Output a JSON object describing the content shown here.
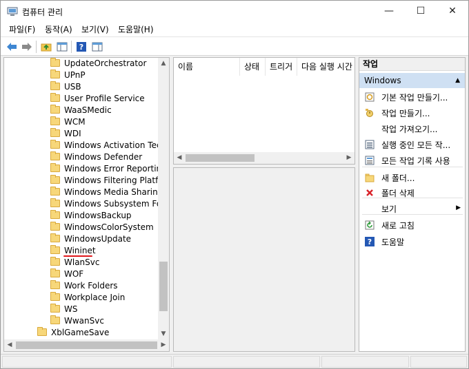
{
  "window": {
    "title": "컴퓨터 관리",
    "minimize_glyph": "—",
    "maximize_glyph": "☐",
    "close_glyph": "✕"
  },
  "menu": {
    "items": [
      "파일(F)",
      "동작(A)",
      "보기(V)",
      "도움말(H)"
    ]
  },
  "toolbar": {
    "icons": [
      "back-arrow-icon",
      "forward-arrow-icon",
      "up-folder-icon",
      "show-hide-tree-icon",
      "help-icon",
      "show-hide-action-pane-icon"
    ]
  },
  "tree": {
    "items": [
      {
        "label": "UpdateOrchestrator",
        "level": 2
      },
      {
        "label": "UPnP",
        "level": 2
      },
      {
        "label": "USB",
        "level": 2
      },
      {
        "label": "User Profile Service",
        "level": 2
      },
      {
        "label": "WaaSMedic",
        "level": 2
      },
      {
        "label": "WCM",
        "level": 2
      },
      {
        "label": "WDI",
        "level": 2
      },
      {
        "label": "Windows Activation Technologies",
        "level": 2
      },
      {
        "label": "Windows Defender",
        "level": 2
      },
      {
        "label": "Windows Error Reporting",
        "level": 2
      },
      {
        "label": "Windows Filtering Platform",
        "level": 2
      },
      {
        "label": "Windows Media Sharing",
        "level": 2
      },
      {
        "label": "Windows Subsystem For Linux",
        "level": 2
      },
      {
        "label": "WindowsBackup",
        "level": 2
      },
      {
        "label": "WindowsColorSystem",
        "level": 2
      },
      {
        "label": "WindowsUpdate",
        "level": 2
      },
      {
        "label": "Wininet",
        "level": 2,
        "underline": true
      },
      {
        "label": "WlanSvc",
        "level": 2
      },
      {
        "label": "WOF",
        "level": 2
      },
      {
        "label": "Work Folders",
        "level": 2
      },
      {
        "label": "Workplace Join",
        "level": 2
      },
      {
        "label": "WS",
        "level": 2
      },
      {
        "label": "WwanSvc",
        "level": 2
      },
      {
        "label": "XblGameSave",
        "level": 1
      }
    ]
  },
  "list": {
    "columns": [
      "이름",
      "상태",
      "트리거",
      "다음 실행 시간"
    ]
  },
  "actions": {
    "header": "작업",
    "section": "Windows",
    "items": [
      {
        "label": "기본 작업 만들기...",
        "icon": "create-basic-task-icon"
      },
      {
        "label": "작업 만들기...",
        "icon": "create-task-icon"
      },
      {
        "label": "작업 가져오기...",
        "icon": ""
      },
      {
        "label": "실행 중인 모든 작...",
        "icon": "running-tasks-icon"
      },
      {
        "label": "모든 작업 기록 사용",
        "icon": "task-history-icon"
      },
      {
        "label": "새 폴더...",
        "icon": "new-folder-icon"
      },
      {
        "label": "폴더 삭제",
        "icon": "delete-icon"
      },
      {
        "label": "보기",
        "icon": "",
        "submenu": true
      },
      {
        "label": "새로 고침",
        "icon": "refresh-icon"
      },
      {
        "label": "도움말",
        "icon": "help-icon"
      }
    ]
  },
  "colors": {
    "accent_underline": "#e0161b",
    "section_highlight": "#cfe0f3",
    "folder_fill": "#f7d77a"
  }
}
